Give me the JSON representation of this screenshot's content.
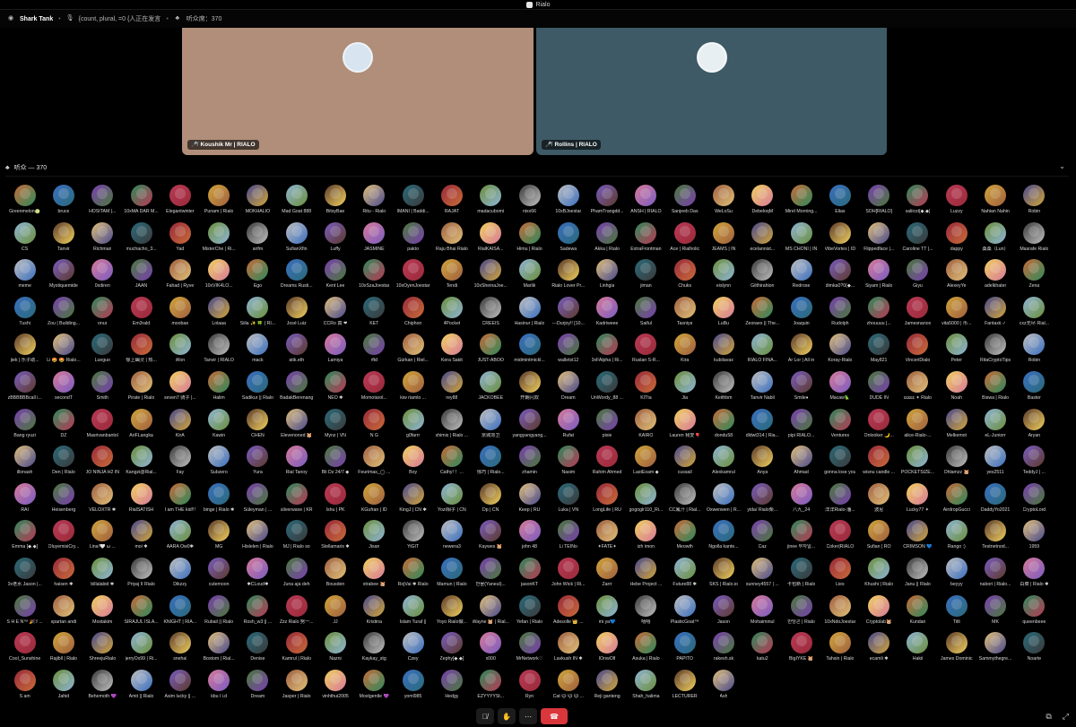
{
  "window": {
    "title": "Rialo"
  },
  "channel": {
    "name": "Shark Tank",
    "topic": "{count, plural, =0 {人正在发言",
    "listeners_label": "听众席：370"
  },
  "speakers": [
    {
      "name": "Koushik Mr | RIALO",
      "tag": "",
      "color": "#b08e7a",
      "avatar_color": "#d8e4f0"
    },
    {
      "name": "Rollins | RIALO",
      "tag": "",
      "color": "#3e5a66",
      "avatar_color": "#e8eff3"
    }
  ],
  "audience": {
    "label": "听众 — 370",
    "members": [
      "Greenmelon🍈",
      "bruce",
      "HOSITAM |...",
      "10xMA DAR M...",
      "Elegantwinter",
      "Punam | Rialo",
      "MOKHALIO",
      "Mad Goat 888",
      "BitsyBae",
      "Ritu - Rialo",
      "IMANI | Baddi...",
      "RAJAT",
      "madacubomi",
      "nixx66",
      "10xBJoestar",
      "PhamTrangdd...",
      "ANSH | RIALO",
      "Sanjeeb Das",
      "WeLoSu",
      "DebeloqM",
      "Mirel Morning...",
      "Elias",
      "SOH[RIALO]",
      "saliicst[◆,◆]",
      "Luzzy",
      "Nahian Nahin",
      "Robin",
      "CS",
      "Tanvir",
      "Richman",
      "muchacho_3...",
      "Yad",
      "MisterChe | Ri...",
      "arifm",
      "SufianXfin",
      "Luffy",
      "JASMINE",
      "pakto",
      "Raju Bhai Rialo",
      "RialKAISA...",
      "Himu | Rialo",
      "Sadewa",
      "Akka | Rialo",
      "ExtraFrontman",
      "Ace | Rialholic",
      "JEAMS | IN",
      "ecelannist...",
      "MS CHONI | IN",
      "VibeVortex | ID",
      "Flippedface |...",
      "Caroline TT |...",
      "dappy",
      "桑桑（Lun）",
      "Masrafe Rialo",
      "meme",
      "Mystiquemide",
      "0xdiren",
      "JAAN",
      "Fahad | Ryve",
      "10xVIK4LO...",
      "Ego",
      "Dreams Rusti...",
      "Kent Lee",
      "10xSzaJoestar",
      "10xOyenJoestar",
      "Tendi",
      "10xSheinaJoe...",
      "Marlik",
      "Rialo Lover Pr...",
      "Linhgia",
      "jiman",
      "Chuks",
      "eislynn",
      "Gilthirahion",
      "Redrose",
      "dimka0?0(◆...",
      "Siyam | Rialo",
      "Giyu",
      "AlexeyYe",
      "adelkhater",
      "Zena",
      "Tushi",
      "Zou | Building...",
      "onur",
      "Em3rald",
      "moobae",
      "Lolaaa",
      "Siila ✨ 🍀 | RI...",
      "José Luiz",
      "CCRo 真 ❤",
      "KET",
      "Chiphon",
      "4Pocket",
      "CREEIS",
      "Hasinur | Rialo",
      "---Durjoy!! [10...",
      "Kadriweee",
      "Saiful",
      "Tasniya",
      "LuBu",
      "Zeoraex || The...",
      "Joaquin",
      "Rudolph",
      "zhouuuu |...",
      "Jamesnanox",
      "vita5000 | 币...",
      "Fantaxii.✓",
      "cxz无尽·Rial...",
      "jiek | 乐子助...",
      "Li 🤩 🤩 Rialo...",
      "Lueguo",
      "惊上幽灵 | 热...",
      "Won",
      "Tanvir | RIALO",
      "mack",
      "atik.eth",
      "Lamiya",
      "rftd",
      "Gürkan | Riel...",
      "Kera Sakit",
      "JUST-ABOO",
      "midmintmickl...",
      "walletst12",
      "0xFAlpha | Ri...",
      "Ruslan S-R...",
      "Kira",
      "kubilavax",
      "RIALO FINA...",
      "Ar Lor | All in",
      "Koray-Rialo",
      "May821",
      "VinceriDialo",
      "Peter",
      "RitaCryptoTips",
      "Robin",
      "zBBBBBBcall i...",
      "secondT",
      "Smith",
      "Pirate | Rialo",
      "seven7 骑子 |...",
      "Halim",
      "Sadikur || Rialo",
      "BadakBerenang",
      "NEO ✱",
      "Momotarol...",
      "kiw riamlo ...",
      "rey88",
      "JACKOBEE",
      "开朗闪双",
      "Dream",
      "UnWordy_88 ...",
      "KITta",
      "Jia",
      "Keithbm",
      "Tanvir Nabil",
      "Smile♦",
      "Macaw🦜",
      "DUDE IN",
      "ɛɛɛɛɛ ✦ Rialo",
      "Noah",
      "Biswa | Rialo",
      "Baster",
      "Bang ryuzi",
      "DZ",
      "Masrivanbantol",
      "AriFLangka",
      "KirA",
      "Kawin",
      "CHEN",
      "Elevenoned 🐹",
      "Mynz | VN",
      "N G",
      "g0farrr",
      "shimis | Rialo ...",
      "京城郊卫",
      "yangyangyang...",
      "Rufat",
      "pixie",
      "KAIRO",
      "Lauren 我爱🎈",
      "dondu58",
      "dldwt314 | Ria...",
      "pipi RIALO...",
      "Ventures",
      "Onlooker 🌙...",
      "alice-Rialo-...",
      "Melkemot",
      "eL-Juniorr",
      "Aryan",
      "illonash",
      "Den | Rialo",
      "JO NINJA H2 IN",
      "Kangzi@Rial...",
      "Fay",
      "Subzero",
      "Yura",
      "Rial Tanoy",
      "Bli Dz 24/7 ◆",
      "Feurimas_◯ ...",
      "Boy",
      "Cathy! ！...",
      "惊巧 | Rialo...",
      "zhamin",
      "Nasim",
      "Rahim Ahmed",
      "LastExam ◆",
      "cussail",
      "Alexkamrul",
      "Anya",
      "Ahmad",
      "gonna lose you",
      "wisnu candle ...",
      "POCKETSIZE...",
      "Ohlamzz 🐹",
      "yes2511",
      "TeddyJ | ...",
      "RAI",
      "Heisenberg",
      "VELOXTR ✱",
      "RialSATISH",
      "I am THE kid!!!",
      "binge | Rialo ✱",
      "Süleyman | ...",
      "silverwave | KR",
      "Ishu | PK",
      "KGufran | ID",
      "KingJ | CN ✱",
      "Yozi相子 | CN",
      "Dp | CN",
      "Keep | RU",
      "Luka | VN",
      "LongLife | RU",
      "gogoglr110_Ri...",
      "CC鳳汁 | Rial...",
      "Oxwenwen | R...",
      "yida/ Rialo柴...",
      "八九_24",
      "洋洋Rialo-潘...",
      "波尼",
      "Lucky77 ✦",
      "AirdropGucci",
      "DaddyYo2021",
      "CryptoLord",
      "Emma [◆.◆]",
      "OluyemisiCry...",
      "Lina!🤍 ω ...",
      "moi ✱",
      "AARA Ow0✱",
      "MG",
      "Hislelen | Rialo",
      "MJ | Rialo so",
      "Stellamaris ✱",
      "Jisan",
      "YiĞIT",
      "newera3",
      "Kaywes 🐹",
      "john 48",
      "Li TEINo",
      "✦FATE✦",
      "izh imon",
      "Meowth",
      "Ngolla kante...",
      "Caz",
      "jinee 부자일...",
      "Coker|RIALO",
      "Sufian | RO",
      "CRIMSON 💙",
      "Rango :)",
      "Testnetnod...",
      "1959",
      "0x老水 Jason |...",
      "haisen ✱",
      "billalabid ✱",
      "Priyaj II Rialo",
      "Dikzzy",
      "cutemoon",
      "✱CLoud✱",
      "Juna aja deh",
      "Bousden",
      "xtrabee 🐹",
      "RojVai ✱ Rialo",
      "Mamun | Rialo",
      "만물(Yaneul)...",
      "jasonKT",
      "John Wick | Ri...",
      "Zarrr",
      "Hebe Project ...",
      "Future88 ✱",
      "SKS | Rialo.io",
      "sunney4557 | ...",
      "卡包新 | Rialo",
      "Lies",
      "Khushi | Rialo",
      "Janu || Rialo",
      "beyyy",
      "nabori | Rialo...",
      "白菜 | Rialo ✱",
      "S H E N™ 🎉ﾘ ...",
      "spartan andi",
      "Mostakim",
      "SIRAJUL ISLA...",
      "KNIGHT | RIA...",
      "Rubail || Rialo",
      "Rosh_w3 || ...",
      "Zzz Rialo 努一...",
      "JJ",
      "Kristina",
      "Islam Turaf ||",
      "Yoyo Rialo做...",
      "Wayne 🐹 | Rial...",
      "Yefan | Rialo",
      "Adesolle 👑 ...",
      "mi ya💙",
      "嘻嘻",
      "PlasticGoat™",
      "Jason",
      "Mohaiminul",
      "만당곤 | Rialo",
      "10xNdoJoestar",
      "Cryptolab🐹",
      "Kundan",
      "Titli",
      "MK",
      "queenbeee",
      "Cool_Sunshine",
      "Rajibll | Rialo",
      "ShreejuRialo",
      "jerryOx99 | Ri...",
      "snehal",
      "Bostom | Rial...",
      "Denise",
      "Kamrul | Rialo",
      "Nazni",
      "Kaykay_stg",
      "Czey",
      "Zephy[◆.◆]",
      "x000",
      "MrNetwork♡",
      "Lavkush IN ✱",
      "lOnwOlf",
      "Asuka | Rialo",
      "PAPITO",
      "rakesh.sk",
      "katu2",
      "BigIYKE 🐹",
      "Tahsin | Rialo",
      "ecamli ✱",
      "Hakii",
      "James Dominic",
      "Sammythegre...",
      "Noarte",
      "S am",
      "Jahid",
      "Behemoth 💜",
      "Amit || Rialo",
      "Asim lucky || ...",
      "kbu l i.d",
      "Dream",
      "Jasper | Rialo",
      "vinhthui2005",
      "Mostgentle 💜",
      "yoml985",
      "Hedgy",
      "EZYYYYSt...",
      "Ryn",
      "Cat 🐱 🐱 🐱 ...",
      "Reji ganteng",
      "Shah_halima",
      "LECTURER",
      "Ash"
    ],
    "avatar_colors": [
      "#c76b3a",
      "#3a6fbf",
      "#7a3fb0",
      "#2f8a5c",
      "#b83a55",
      "#d0a43a",
      "#4a4a8f",
      "#8fb4d6",
      "#5c3a2a",
      "#e0c07a",
      "#2a6a7a",
      "#9a2a3a",
      "#6b8f3a",
      "#3a3a3a",
      "#c0c0c0",
      "#7a5cc0",
      "#d87a9a",
      "#4a7a3a",
      "#a06040",
      "#f0d060"
    ]
  },
  "controls": {
    "mic_icon": "mic-muted-icon",
    "hand_icon": "raise-hand-icon",
    "more_icon": "more-icon",
    "leave_icon": "phone-hangup-icon"
  },
  "colors": {
    "background": "#000000",
    "leave": "#da373c",
    "speaker_1": "#b08e7a",
    "speaker_2": "#3e5a66"
  }
}
